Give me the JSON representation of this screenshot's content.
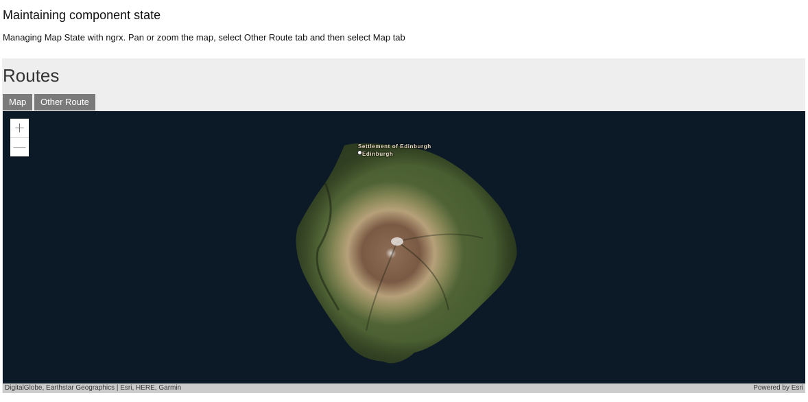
{
  "page": {
    "title": "Maintaining component state",
    "description": "Managing Map State with ngrx. Pan or zoom the map, select Other Route tab and then select Map tab"
  },
  "routes": {
    "heading": "Routes",
    "tabs": [
      {
        "label": "Map"
      },
      {
        "label": "Other Route"
      }
    ]
  },
  "map": {
    "zoom_in_symbol": "+",
    "zoom_out_symbol": "—",
    "labels": {
      "settlement": "Settlement of Edinburgh",
      "town": "Edinburgh"
    },
    "attribution": "DigitalGlobe, Earthstar Geographics | Esri, HERE, Garmin",
    "powered_by": "Powered by Esri",
    "colors": {
      "ocean": "#0c1a27",
      "vegetation": "#4b5e33",
      "peak": "#8a6a52"
    }
  }
}
